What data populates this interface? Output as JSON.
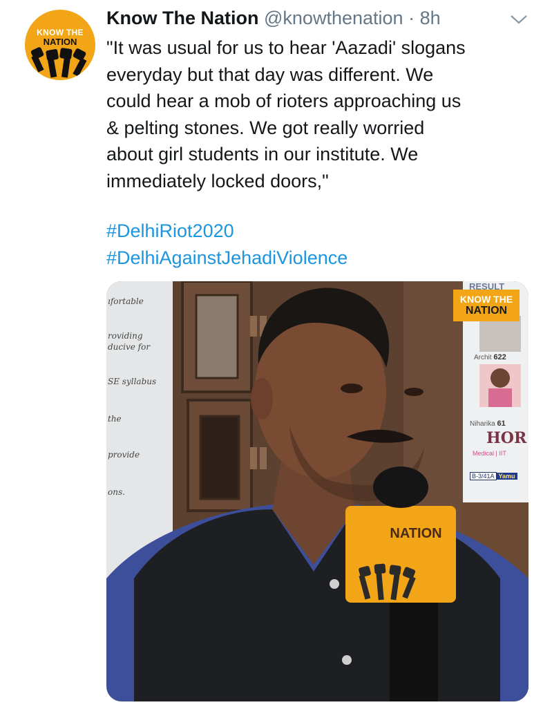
{
  "tweet": {
    "display_name": "Know The Nation",
    "handle": "@knowthenation",
    "separator": "·",
    "time": "8h",
    "text_lines": [
      "\"It was usual for us to hear 'Aazadi' slogans",
      "everyday but that day was different. We",
      "could hear a mob of rioters approaching us",
      "& pelting stones. We got really worried",
      "about girl students in our institute. We",
      "immediately locked doors,\""
    ],
    "hashtags": [
      "#DelhiRiot2020",
      "#DelhiAgainstJehadiViolence"
    ],
    "avatar_logo": {
      "line1": "KNOW THE",
      "line2": "NATION"
    },
    "caret_icon": "chevron-down-icon"
  },
  "media": {
    "watermark": {
      "line1": "KNOW THE",
      "line2": "NATION"
    },
    "poster_result_label": "RESULT",
    "poster_lines": [
      "ıfortable",
      "roviding",
      "ducive for",
      "SE syllabus",
      "the",
      "provide",
      "ons."
    ],
    "poster_names": [
      {
        "name": "Archit",
        "score": "622"
      },
      {
        "name": "Niharika",
        "score": "61"
      }
    ],
    "poster_big": "HOR",
    "poster_small": "Medical | IIT",
    "address_chip": [
      "B-3/41A",
      "Yamu"
    ],
    "mic_flag_text": "NATION"
  },
  "colors": {
    "link": "#1b95e0",
    "text": "#14171a",
    "secondary": "#657786",
    "brand_orange": "#f2a516"
  }
}
